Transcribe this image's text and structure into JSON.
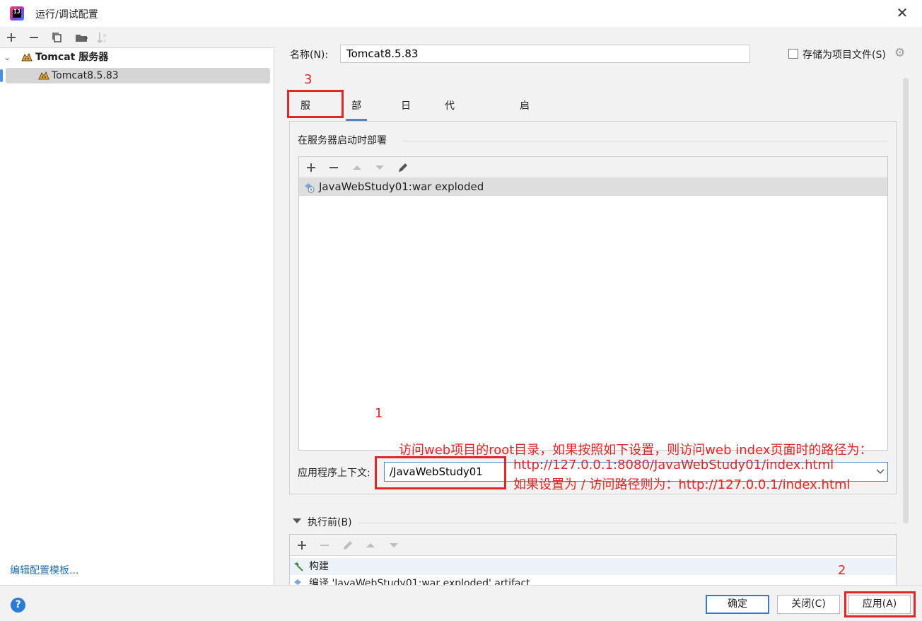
{
  "window": {
    "title": "运行/调试配置",
    "close": "✕"
  },
  "left": {
    "tree": [
      {
        "label": "Tomcat 服务器",
        "bold": true
      },
      {
        "label": "Tomcat8.5.83"
      }
    ],
    "edit_templates": "编辑配置模板..."
  },
  "form": {
    "name_label": "名称(N):",
    "name_value": "Tomcat8.5.83",
    "store_as_file": "存储为项目文件(S)"
  },
  "tabs": [
    "服务器",
    "部署",
    "日志",
    "代码覆盖率",
    "启动/连接"
  ],
  "deploy": {
    "section_title": "在服务器启动时部署",
    "artifacts": [
      "JavaWebStudy01:war exploded"
    ],
    "context_label": "应用程序上下文:",
    "context_value": "/JavaWebStudy01"
  },
  "before_launch": {
    "title": "执行前(B)",
    "items": [
      "构建",
      "编译 'JavaWebStudy01:war exploded' artifact"
    ]
  },
  "buttons": {
    "ok": "确定",
    "close": "关闭(C)",
    "apply": "应用(A)",
    "help": "?"
  },
  "annotations": {
    "n1": "1",
    "n2": "2",
    "n3": "3",
    "line1": "访问web项目的root目录，如果按照如下设置，则访问web index页面时的路径为：",
    "line2": "http://127.0.0.1:8080/JavaWebStudy01/index.html",
    "line3": "如果设置为 / 访问路径则为：http://127.0.0.1/index.html",
    "color": "#e12626"
  }
}
